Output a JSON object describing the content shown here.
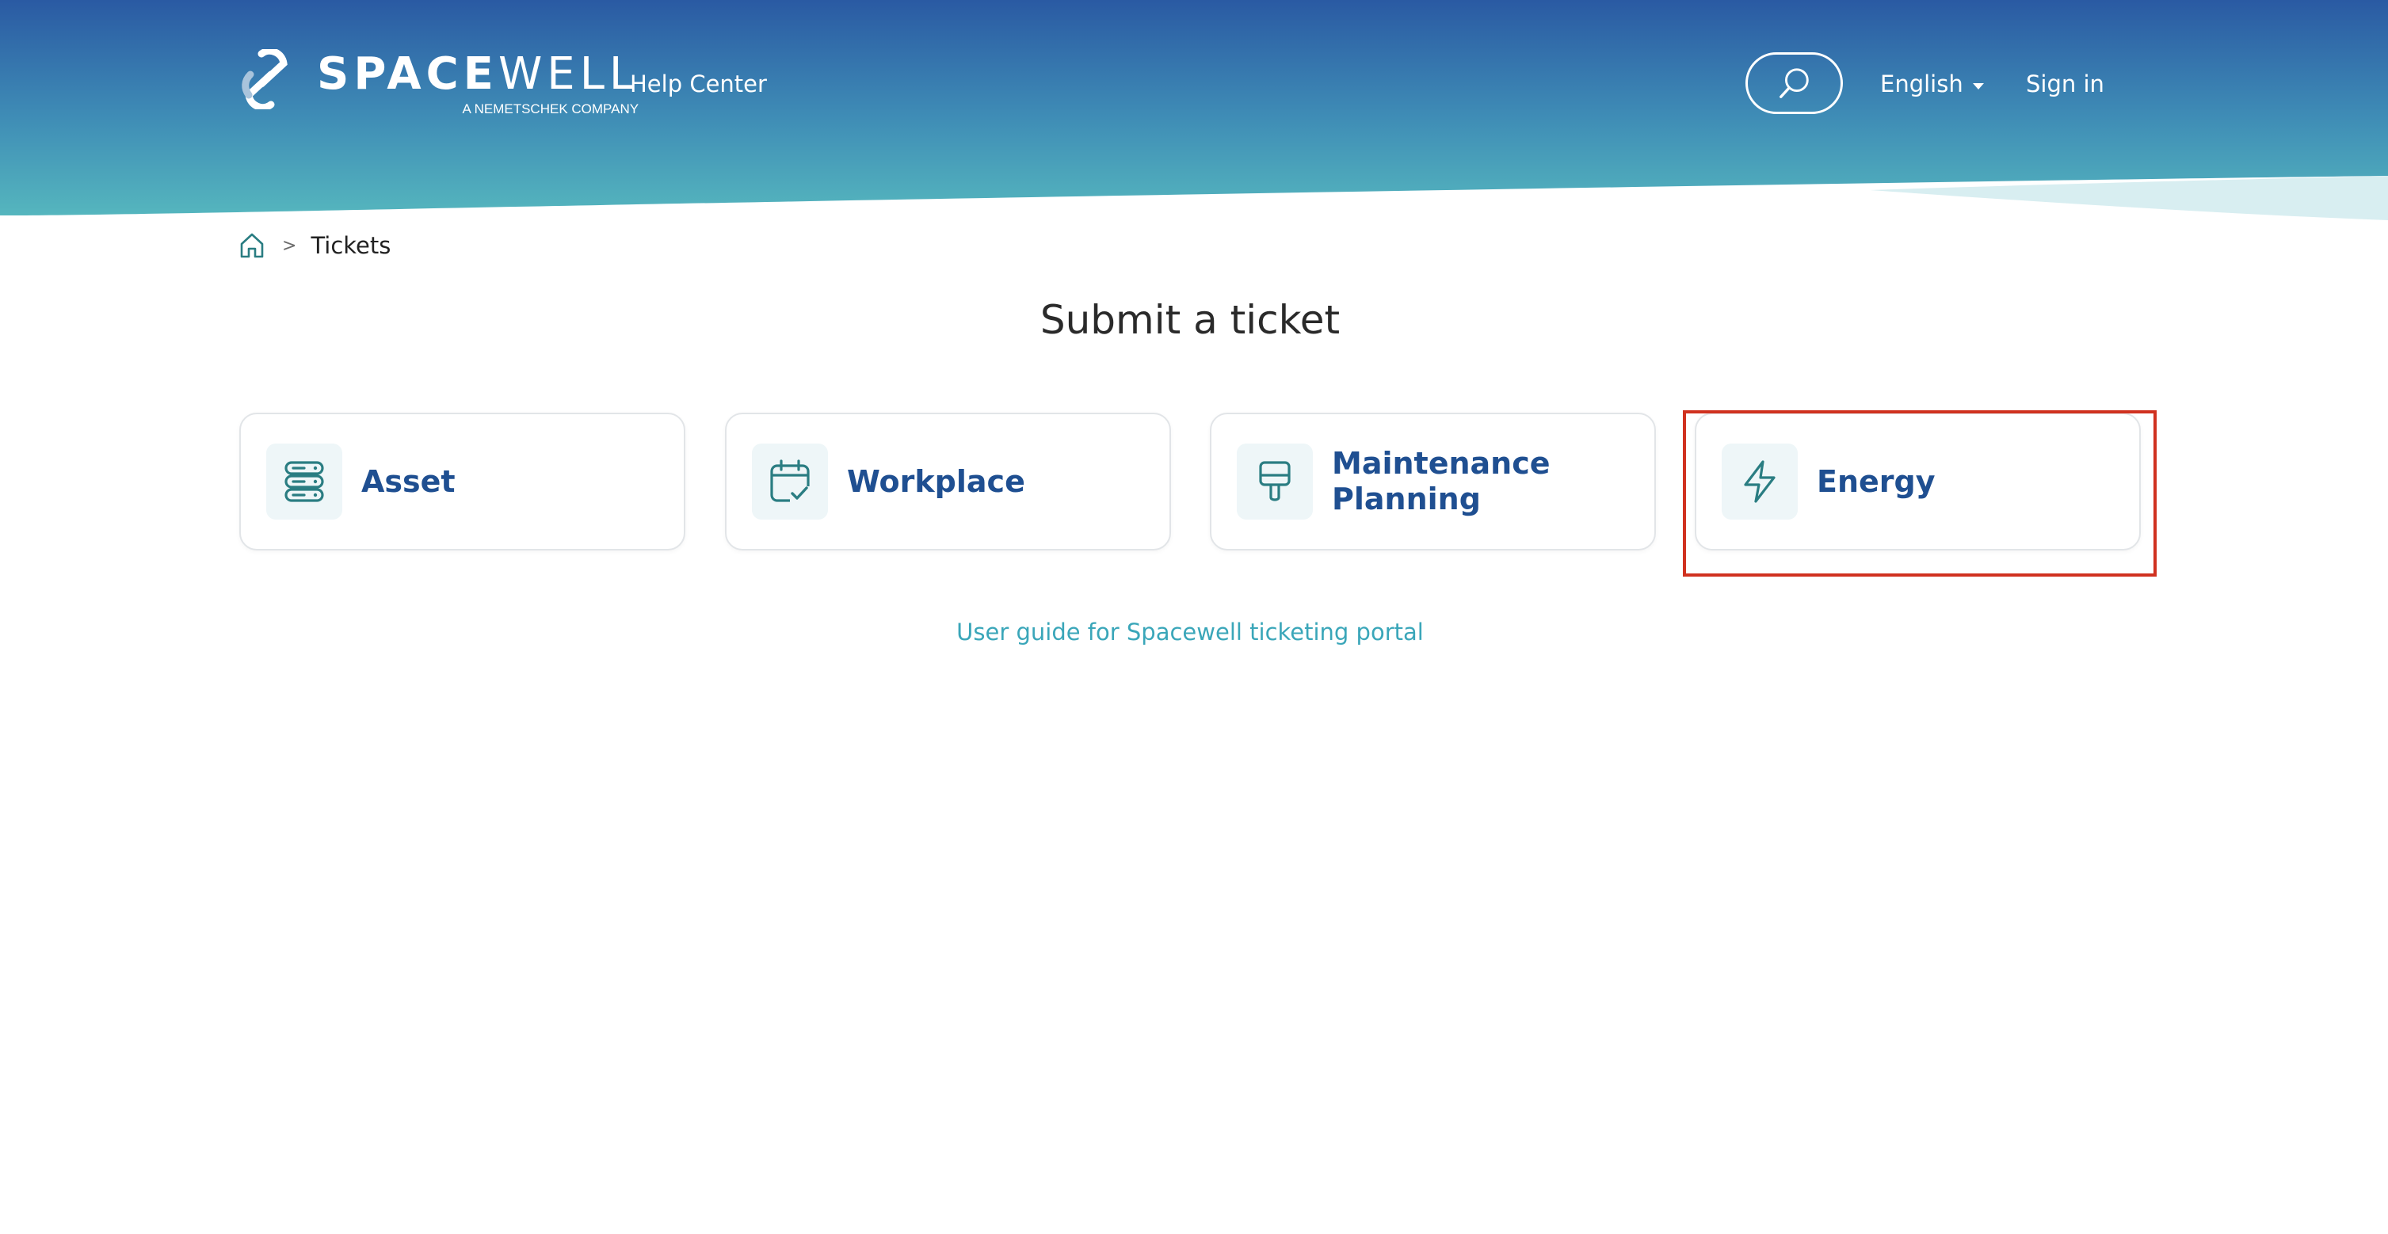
{
  "colors": {
    "header_top": "#2a5aa3",
    "header_bottom": "#4fb3bf",
    "card_label": "#1f4f91",
    "icon_stroke": "#2a7d82",
    "link": "#3aa6b9",
    "highlight": "#d0311f"
  },
  "header": {
    "logo_word_bold": "SPACE",
    "logo_word_light": "WELL",
    "logo_tagline": "A NEMETSCHEK COMPANY",
    "help_center": "Help Center",
    "search_icon": "search-icon",
    "language": "English",
    "sign_in": "Sign in"
  },
  "breadcrumb": {
    "home_icon": "home-icon",
    "separator": ">",
    "current": "Tickets"
  },
  "main": {
    "title": "Submit a ticket",
    "cards": [
      {
        "label": "Asset",
        "icon": "server-icon"
      },
      {
        "label": "Workplace",
        "icon": "calendar-check-icon"
      },
      {
        "label": "Maintenance Planning",
        "icon": "paint-brush-icon"
      },
      {
        "label": "Energy",
        "icon": "lightning-icon"
      }
    ],
    "guide_link": "User guide for Spacewell ticketing portal"
  }
}
